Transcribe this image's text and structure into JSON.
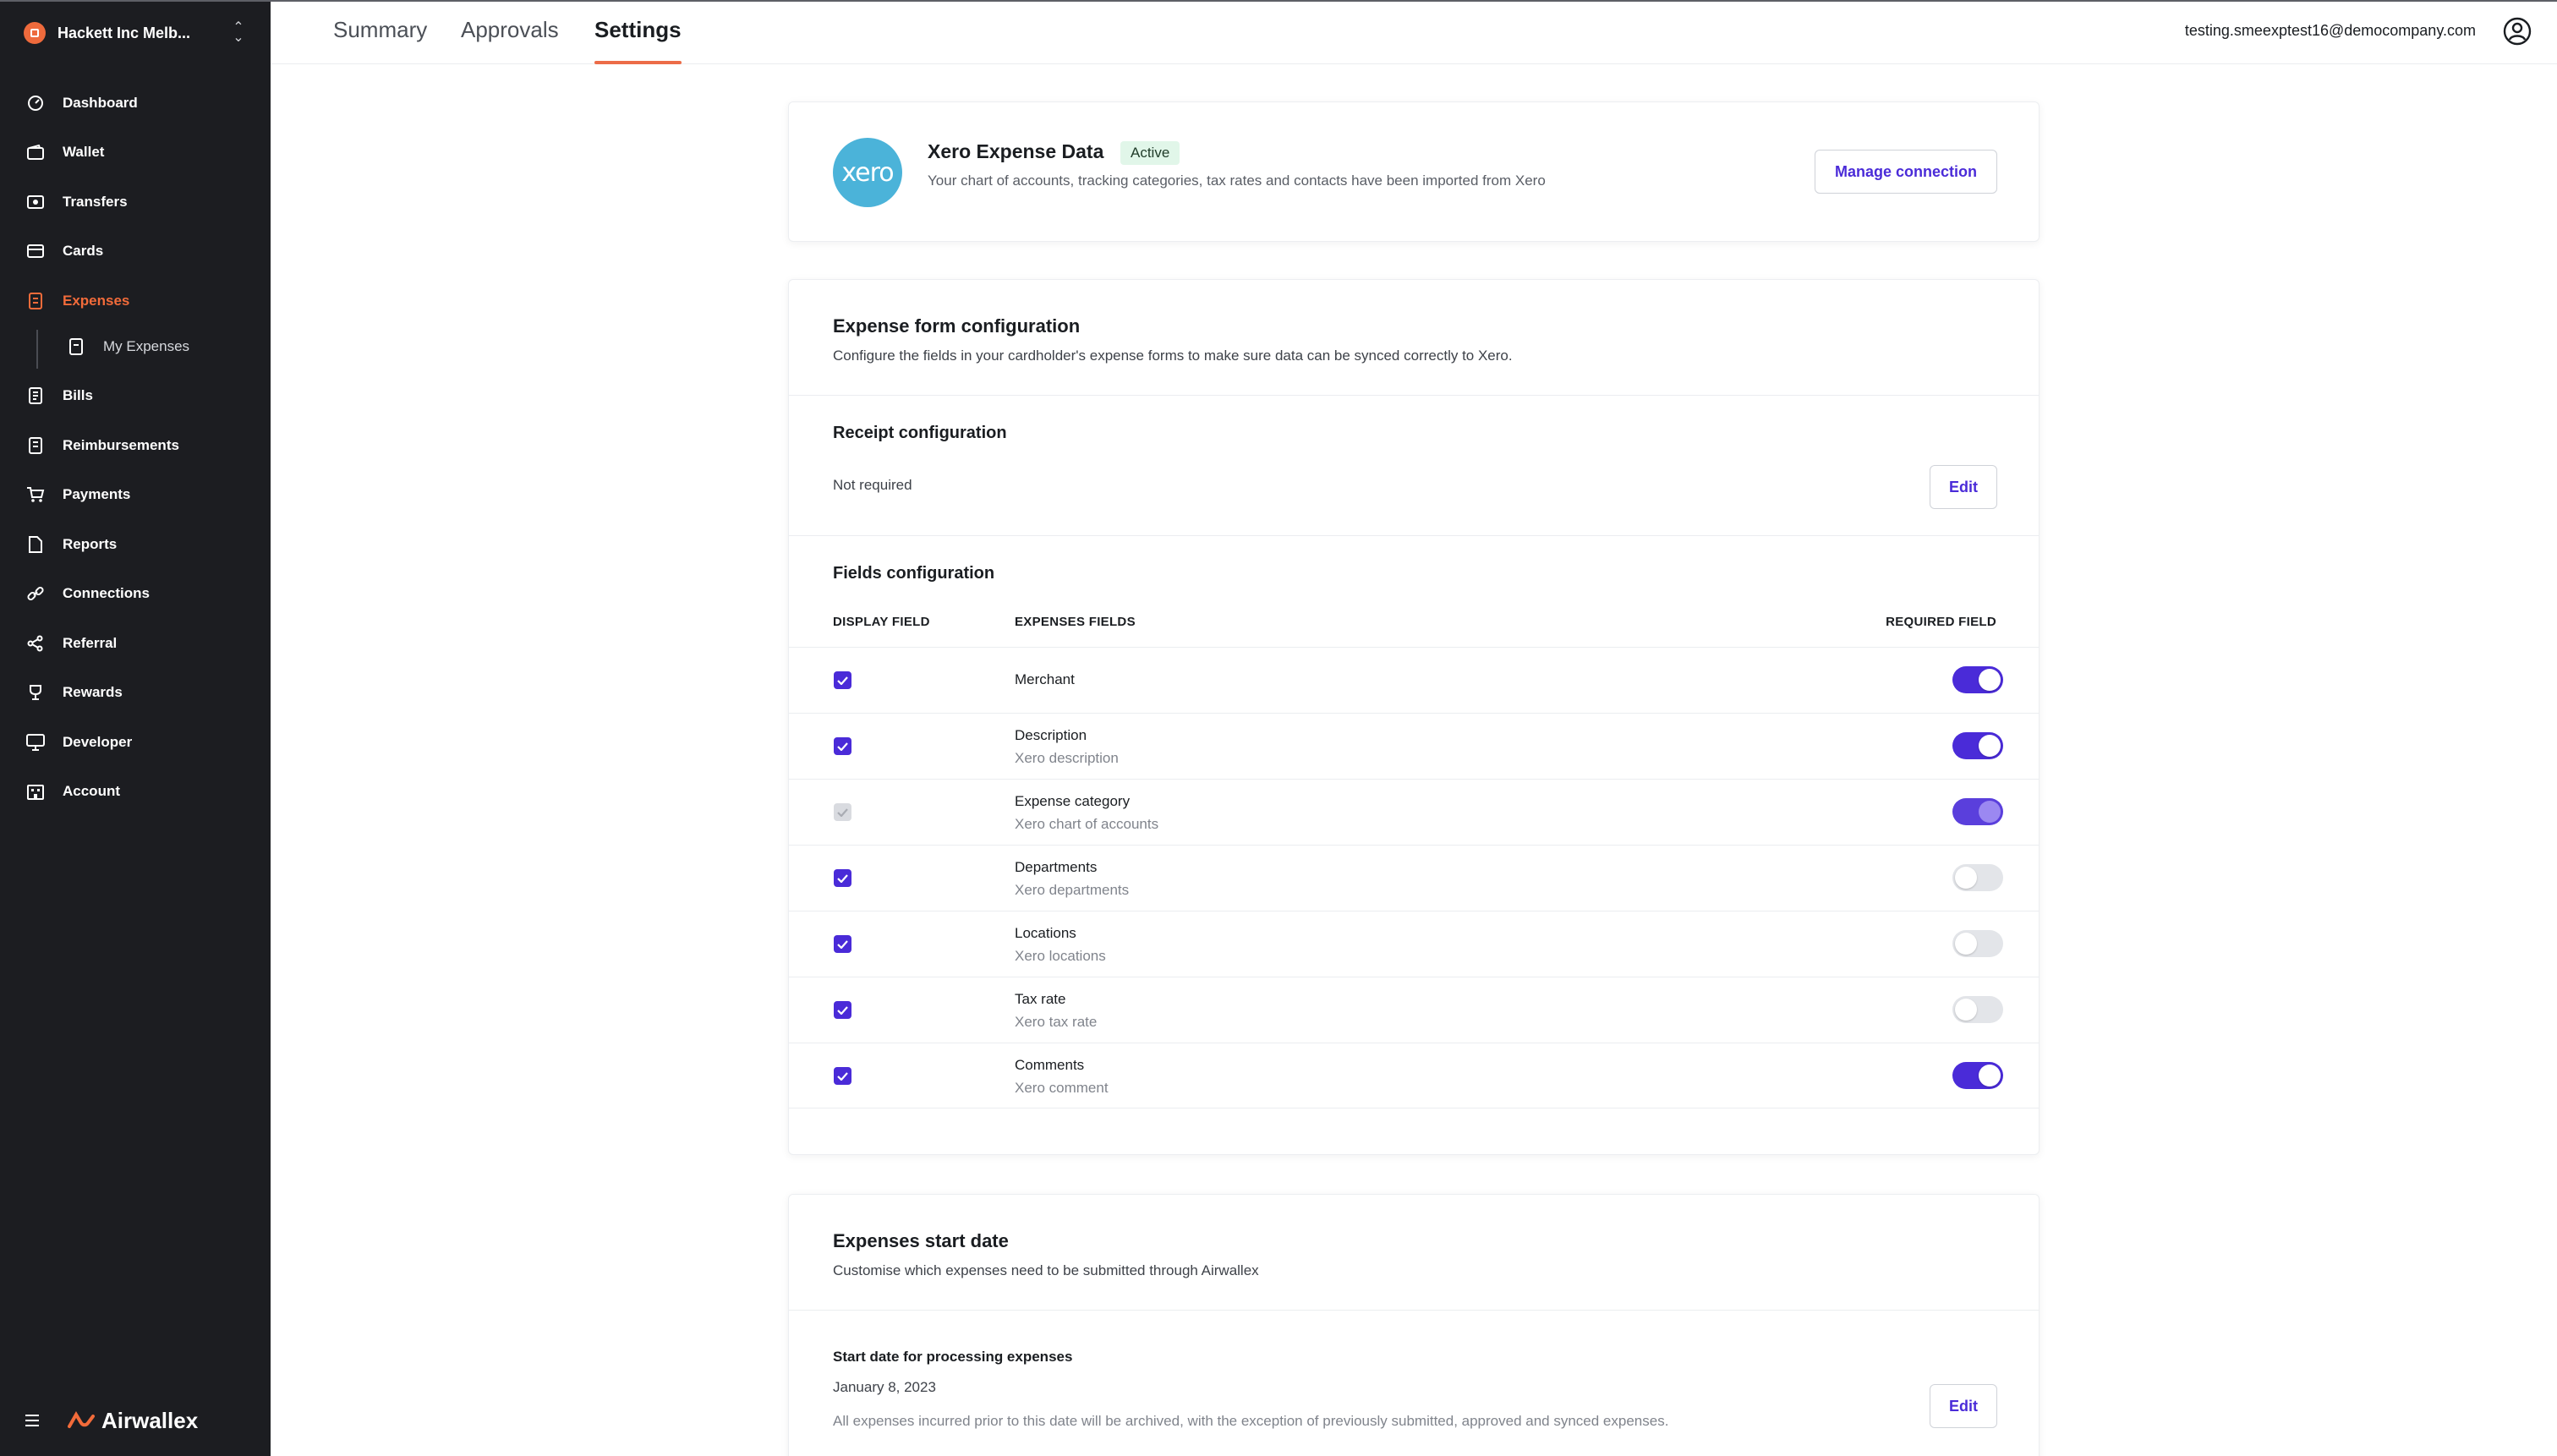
{
  "sidebar": {
    "org_name": "Hackett Inc Melb...",
    "nav": [
      {
        "label": "Dashboard",
        "icon": "dashboard-icon"
      },
      {
        "label": "Wallet",
        "icon": "wallet-icon"
      },
      {
        "label": "Transfers",
        "icon": "transfers-icon"
      },
      {
        "label": "Cards",
        "icon": "card-icon"
      },
      {
        "label": "Expenses",
        "icon": "expenses-icon",
        "active": true
      },
      {
        "label": "My Expenses",
        "icon": "receipt-icon",
        "sub": true
      },
      {
        "label": "Bills",
        "icon": "bill-icon"
      },
      {
        "label": "Reimbursements",
        "icon": "reimbursement-icon"
      },
      {
        "label": "Payments",
        "icon": "cart-icon"
      },
      {
        "label": "Reports",
        "icon": "report-icon"
      },
      {
        "label": "Connections",
        "icon": "link-icon"
      },
      {
        "label": "Referral",
        "icon": "share-icon"
      },
      {
        "label": "Rewards",
        "icon": "trophy-icon"
      },
      {
        "label": "Developer",
        "icon": "monitor-icon"
      },
      {
        "label": "Account",
        "icon": "building-icon"
      }
    ],
    "brand": "Airwallex"
  },
  "header": {
    "tabs": [
      {
        "label": "Summary"
      },
      {
        "label": "Approvals"
      },
      {
        "label": "Settings",
        "active": true
      }
    ],
    "user_email": "testing.smeexptest16@democompany.com"
  },
  "xero": {
    "logo_text": "xero",
    "title": "Xero Expense Data",
    "status": "Active",
    "description": "Your chart of accounts, tracking categories, tax rates and contacts have been imported from Xero",
    "manage_label": "Manage connection"
  },
  "expense_form": {
    "title": "Expense form configuration",
    "subtitle": "Configure the fields in your cardholder's expense forms to make sure data can be synced correctly to Xero.",
    "receipt": {
      "title": "Receipt configuration",
      "value": "Not required",
      "edit_label": "Edit"
    },
    "fields": {
      "title": "Fields configuration",
      "columns": {
        "display": "DISPLAY FIELD",
        "expenses": "EXPENSES FIELDS",
        "required": "REQUIRED FIELD"
      },
      "rows": [
        {
          "name": "Merchant",
          "sub": "",
          "display": true,
          "required": true
        },
        {
          "name": "Description",
          "sub": "Xero description",
          "display": true,
          "required": true
        },
        {
          "name": "Expense category",
          "sub": "Xero chart of accounts",
          "display": true,
          "required": true,
          "locked": true
        },
        {
          "name": "Departments",
          "sub": "Xero departments",
          "display": true,
          "required": false
        },
        {
          "name": "Locations",
          "sub": "Xero locations",
          "display": true,
          "required": false
        },
        {
          "name": "Tax rate",
          "sub": "Xero tax rate",
          "display": true,
          "required": false
        },
        {
          "name": "Comments",
          "sub": "Xero comment",
          "display": true,
          "required": true
        }
      ]
    }
  },
  "start_date": {
    "title": "Expenses start date",
    "subtitle": "Customise which expenses need to be submitted through Airwallex",
    "label": "Start date for processing expenses",
    "value": "January 8, 2023",
    "note": "All expenses incurred prior to this date will be archived, with the exception of previously submitted, approved and synced expenses.",
    "edit_label": "Edit"
  },
  "colors": {
    "accent": "#4a2bd8",
    "brand_orange": "#f26b3a",
    "sidebar_bg": "#1c1d21",
    "xero_blue": "#4bb3d9",
    "active_badge_bg": "#e1f6e9"
  }
}
